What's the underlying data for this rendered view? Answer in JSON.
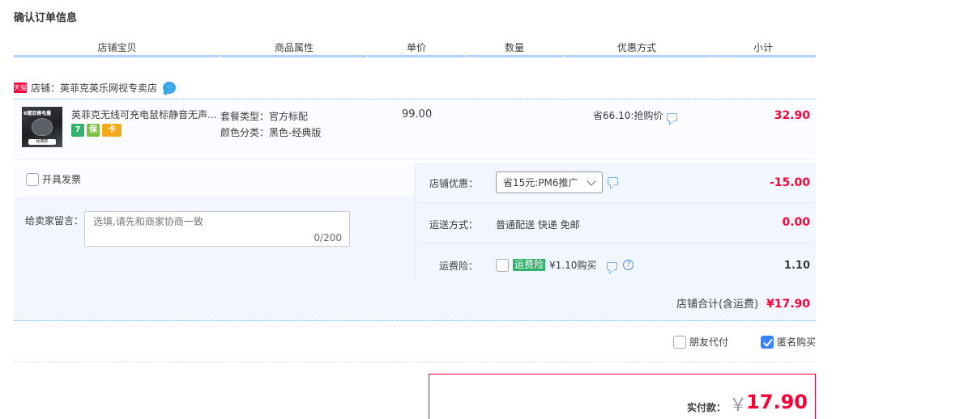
{
  "page": {
    "title": "确认订单信息"
  },
  "headers": {
    "shop_item": "店铺宝贝",
    "attributes": "商品属性",
    "unit_price": "单价",
    "quantity": "数量",
    "discount": "优惠方式",
    "subtotal": "小计"
  },
  "shop": {
    "badge": "天猫",
    "label": "店铺：英菲克英乐网视专卖店",
    "chat_icon": "chat-bubble-icon"
  },
  "item": {
    "thumb_caption_top": "6键双模电量",
    "thumb_caption_bottom": "经典款",
    "title": "英菲克无线可充电鼠标静音无声...",
    "services": [
      "7",
      "保",
      "卡"
    ],
    "attr1_key": "套餐类型：",
    "attr1_val": "官方标配",
    "attr2_key": "颜色分类：",
    "attr2_val": "黑色-经典版",
    "unit_price": "99.00",
    "discount": "省66.10:抢购价",
    "subtotal": "32.90"
  },
  "invoice": {
    "label": "开具发票",
    "checked": false
  },
  "memo": {
    "label": "给卖家留言：",
    "placeholder": "选填,请先和商家协商一致",
    "count": "0/200"
  },
  "shop_discount": {
    "label": "店铺优惠：",
    "selected": "省15元:PM6推广",
    "amount": "-15.00"
  },
  "shipping": {
    "label": "运送方式：",
    "value": "普通配送 快递 免邮",
    "amount": "0.00"
  },
  "insurance": {
    "label": "运费险：",
    "tag": "运费险",
    "price": "¥1.10购买",
    "amount": "1.10",
    "help": "?"
  },
  "shop_total": {
    "label": "店铺合计(含运费)",
    "amount": "¥17.90"
  },
  "payment_options": {
    "friend_pay": "朋友代付",
    "anonymous": "匿名购买",
    "friend_checked": false,
    "anonymous_checked": true
  },
  "pay_summary": {
    "label": "实付款：",
    "currency": "￥",
    "amount": "17.90"
  },
  "colors": {
    "accent_red": "#ff0036",
    "header_bar": "#b2d1ff",
    "panel_bg": "#f2f7ff",
    "insurance_green": "#32b16c",
    "checkbox_blue": "#3b82f6"
  }
}
